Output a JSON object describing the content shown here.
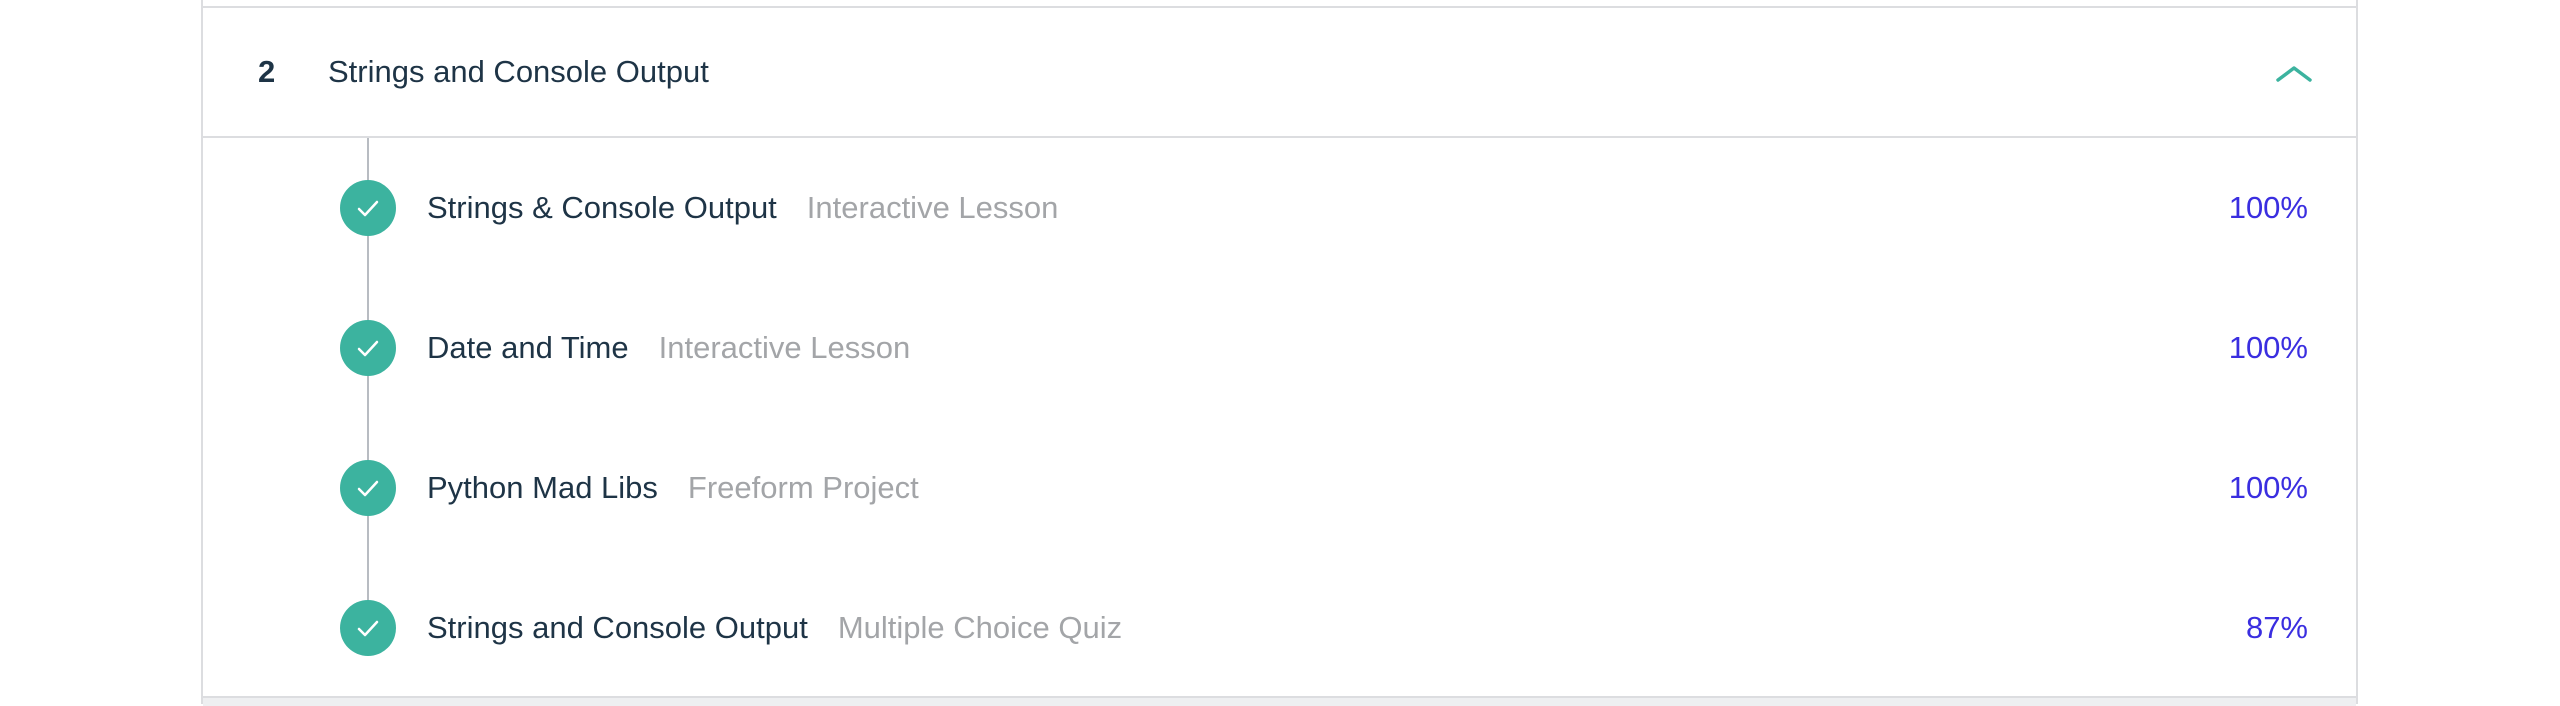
{
  "section": {
    "number": "2",
    "title": "Strings and Console Output",
    "expanded": true,
    "toggle_icon": "chevron-up-icon",
    "accent_color": "#3cb39f"
  },
  "lessons": [
    {
      "title": "Strings & Console Output",
      "type": "Interactive Lesson",
      "progress": "100%",
      "status_icon": "check-circle-icon"
    },
    {
      "title": "Date and Time",
      "type": "Interactive Lesson",
      "progress": "100%",
      "status_icon": "check-circle-icon"
    },
    {
      "title": "Python Mad Libs",
      "type": "Freeform Project",
      "progress": "100%",
      "status_icon": "check-circle-icon"
    },
    {
      "title": "Strings and Console Output",
      "type": "Multiple Choice Quiz",
      "progress": "87%",
      "status_icon": "check-circle-icon"
    }
  ],
  "colors": {
    "text_primary": "#1e3446",
    "text_secondary": "#a3a5a8",
    "progress": "#3a2ee0",
    "check": "#3cb39f",
    "border": "#dcdde0"
  }
}
